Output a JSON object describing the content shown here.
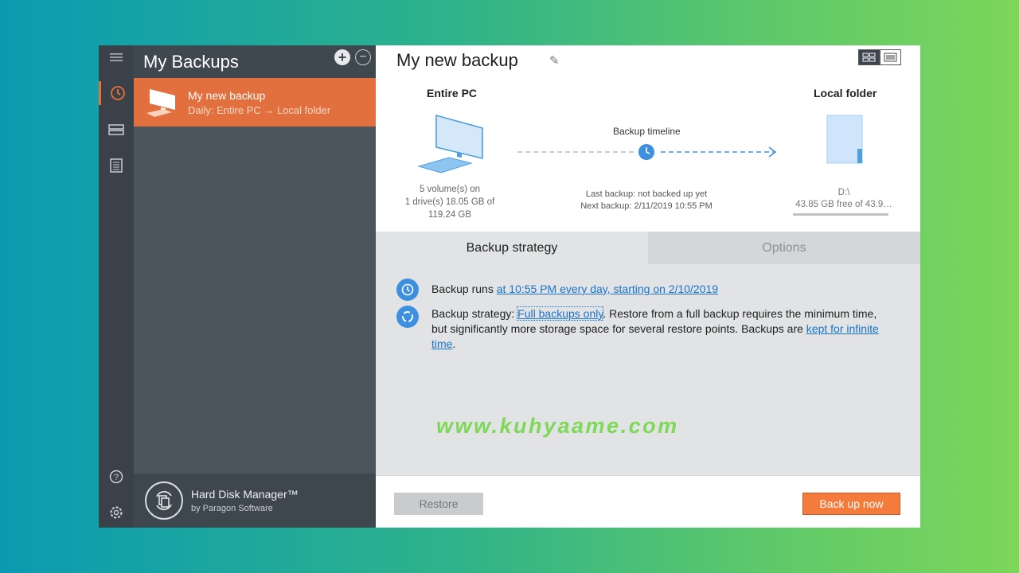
{
  "sidebar": {
    "title": "My Backups",
    "job": {
      "title": "My new backup",
      "subtitle": "Daily: Entire PC → Local folder"
    },
    "footer": {
      "name": "Hard Disk Manager™",
      "by": "by Paragon Software"
    }
  },
  "rail": {
    "icons": [
      "menu-icon",
      "history-icon",
      "drives-icon",
      "log-icon",
      "help-icon",
      "settings-icon"
    ]
  },
  "main": {
    "title": "My new backup",
    "source": {
      "label": "Entire PC",
      "info_line1": "5 volume(s) on",
      "info_line2": "1 drive(s) 18.05 GB of",
      "info_line3": "119.24 GB"
    },
    "timeline": {
      "label": "Backup timeline",
      "last": "Last backup: not backed up yet",
      "next": "Next backup: 2/11/2019 10:55 PM"
    },
    "destination": {
      "label": "Local folder",
      "path": "D:\\",
      "free": "43.85 GB free of 43.9…"
    },
    "tabs": [
      {
        "label": "Backup strategy"
      },
      {
        "label": "Options"
      }
    ],
    "schedule": {
      "prefix": "Backup runs ",
      "link": "at 10:55 PM every day, starting on 2/10/2019"
    },
    "strategy": {
      "prefix": "Backup strategy: ",
      "link": "Full backups only",
      "text": ". Restore from a full backup requires the minimum time, but significantly more storage space for several restore points. Backups are ",
      "link2": "kept for infinite time",
      "suffix": "."
    },
    "watermark": "www.kuhyaame.com",
    "buttons": {
      "restore": "Restore",
      "backup": "Back up now"
    }
  },
  "colors": {
    "accent": "#e2703e",
    "link": "#1b73c9",
    "sidebar": "#4b555e",
    "rail": "#3a4149"
  }
}
